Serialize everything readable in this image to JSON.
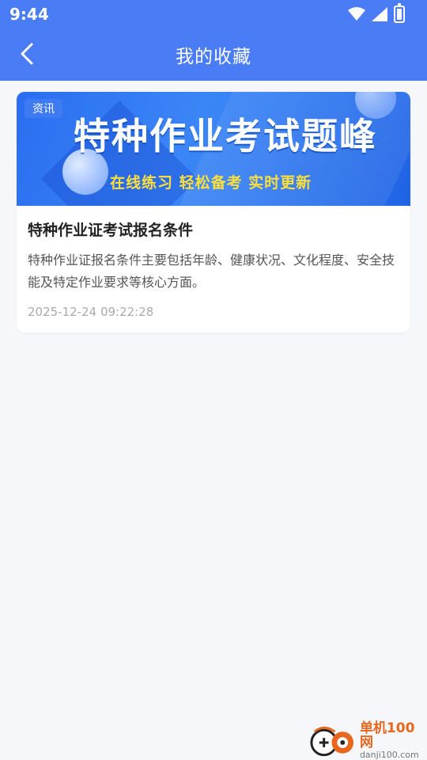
{
  "status_bar": {
    "time": "9:44"
  },
  "app_bar": {
    "title": "我的收藏"
  },
  "favorites": [
    {
      "banner": {
        "tag": "资讯",
        "title": "特种作业考试题峰",
        "subtitle": "在线练习 轻松备考 实时更新"
      },
      "title": "特种作业证考试报名条件",
      "summary": "特种作业证报名条件主要包括年龄、健康状况、文化程度、安全技能及特定作业要求等核心方面。",
      "time": "2025-12-24 09:22:28"
    }
  ],
  "watermark": {
    "name": "单机100网",
    "url": "danji100.com"
  },
  "colors": {
    "primary": "#4a7cf6",
    "banner_subtitle": "#ffe03a",
    "background": "#f5f7fa"
  }
}
